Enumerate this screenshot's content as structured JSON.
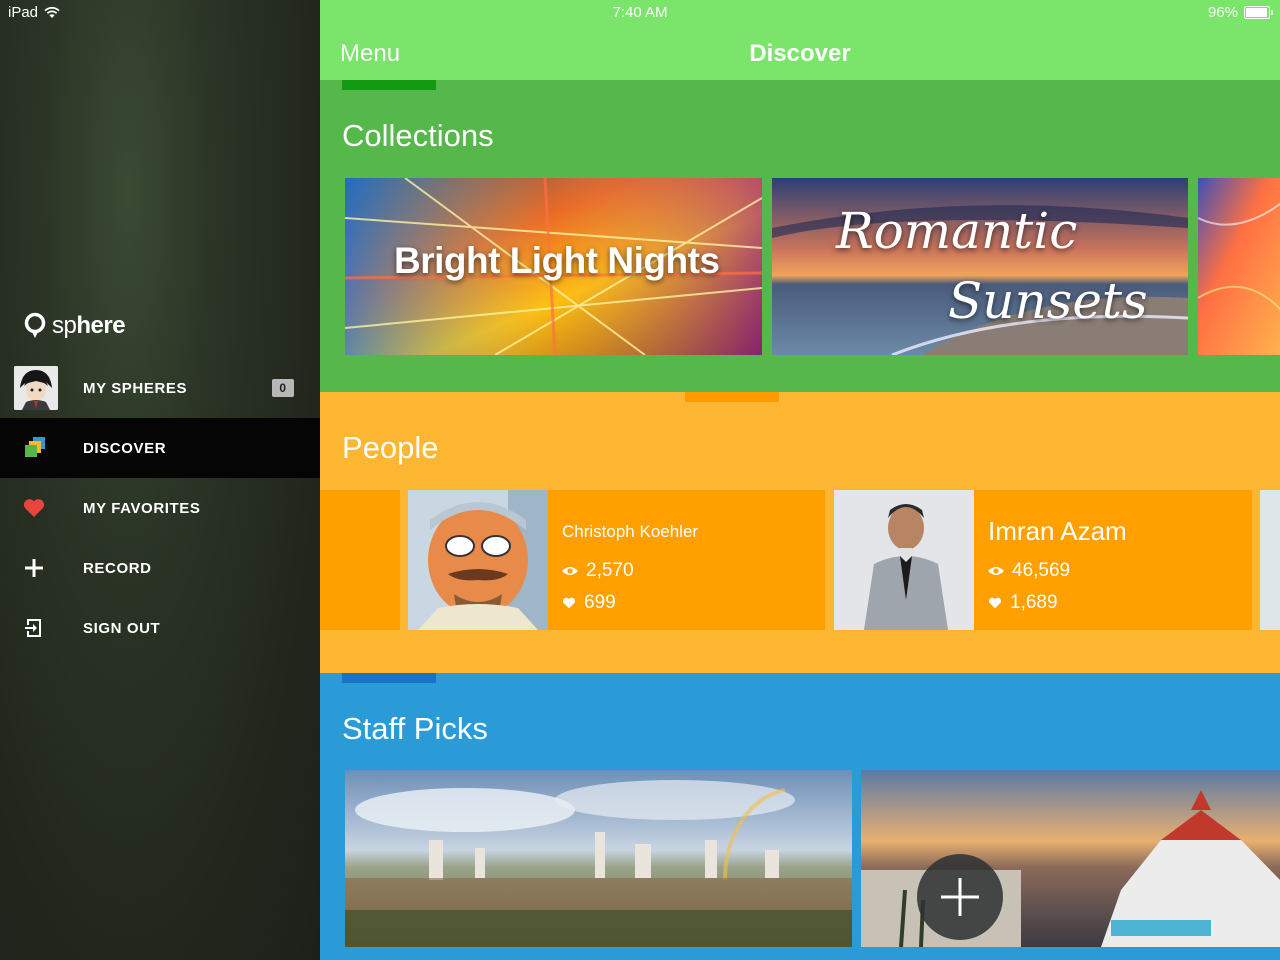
{
  "status_bar": {
    "device": "iPad",
    "time": "7:40 AM",
    "battery": "96%",
    "battery_level": 0.96
  },
  "sidebar": {
    "brand": {
      "prefix": "sp",
      "suffix": "here"
    },
    "items": [
      {
        "label": "MY SPHERES",
        "icon": "avatar",
        "count": "0"
      },
      {
        "label": "DISCOVER",
        "icon": "stacked-layers-icon",
        "active": true
      },
      {
        "label": "MY FAVORITES",
        "icon": "heart-icon"
      },
      {
        "label": "RECORD",
        "icon": "plus-icon"
      },
      {
        "label": "SIGN OUT",
        "icon": "sign-out-icon"
      }
    ]
  },
  "header": {
    "menu_label": "Menu",
    "title": "Discover"
  },
  "collections": {
    "title": "Collections",
    "items": [
      {
        "title": "Bright Light Nights"
      },
      {
        "title_line1": "Romantic",
        "title_line2": "Sunsets"
      }
    ]
  },
  "people": {
    "title": "People",
    "items": [
      {
        "name": "Christoph Koehler",
        "views": "2,570",
        "likes": "699"
      },
      {
        "name": "Imran Azam",
        "views": "46,569",
        "likes": "1,689"
      }
    ]
  },
  "staff_picks": {
    "title": "Staff Picks"
  },
  "colors": {
    "header_green": "#7be56b",
    "collections_green": "#56b74a",
    "people_yellow": "#fdb631",
    "people_card_orange": "#ffa000",
    "staff_blue": "#2a9bd7",
    "favorites_red": "#e8453c"
  }
}
